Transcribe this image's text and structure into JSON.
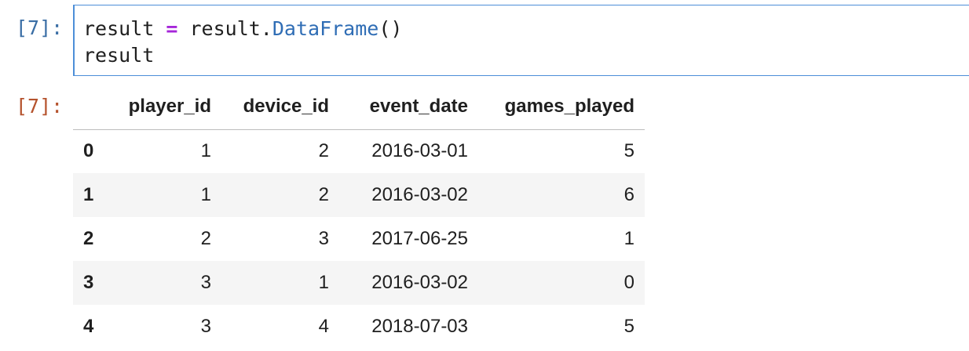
{
  "cell": {
    "input_prompt": "[7]:",
    "output_prompt": "[7]:",
    "code": {
      "line1": {
        "var": "result",
        "op": "=",
        "obj": "result.",
        "attr": "DataFrame",
        "call": "()"
      },
      "line2": "result"
    }
  },
  "dataframe": {
    "columns": [
      "player_id",
      "device_id",
      "event_date",
      "games_played"
    ],
    "rows": [
      {
        "index": "0",
        "player_id": "1",
        "device_id": "2",
        "event_date": "2016-03-01",
        "games_played": "5"
      },
      {
        "index": "1",
        "player_id": "1",
        "device_id": "2",
        "event_date": "2016-03-02",
        "games_played": "6"
      },
      {
        "index": "2",
        "player_id": "2",
        "device_id": "3",
        "event_date": "2017-06-25",
        "games_played": "1"
      },
      {
        "index": "3",
        "player_id": "3",
        "device_id": "1",
        "event_date": "2016-03-02",
        "games_played": "0"
      },
      {
        "index": "4",
        "player_id": "3",
        "device_id": "4",
        "event_date": "2018-07-03",
        "games_played": "5"
      }
    ]
  }
}
